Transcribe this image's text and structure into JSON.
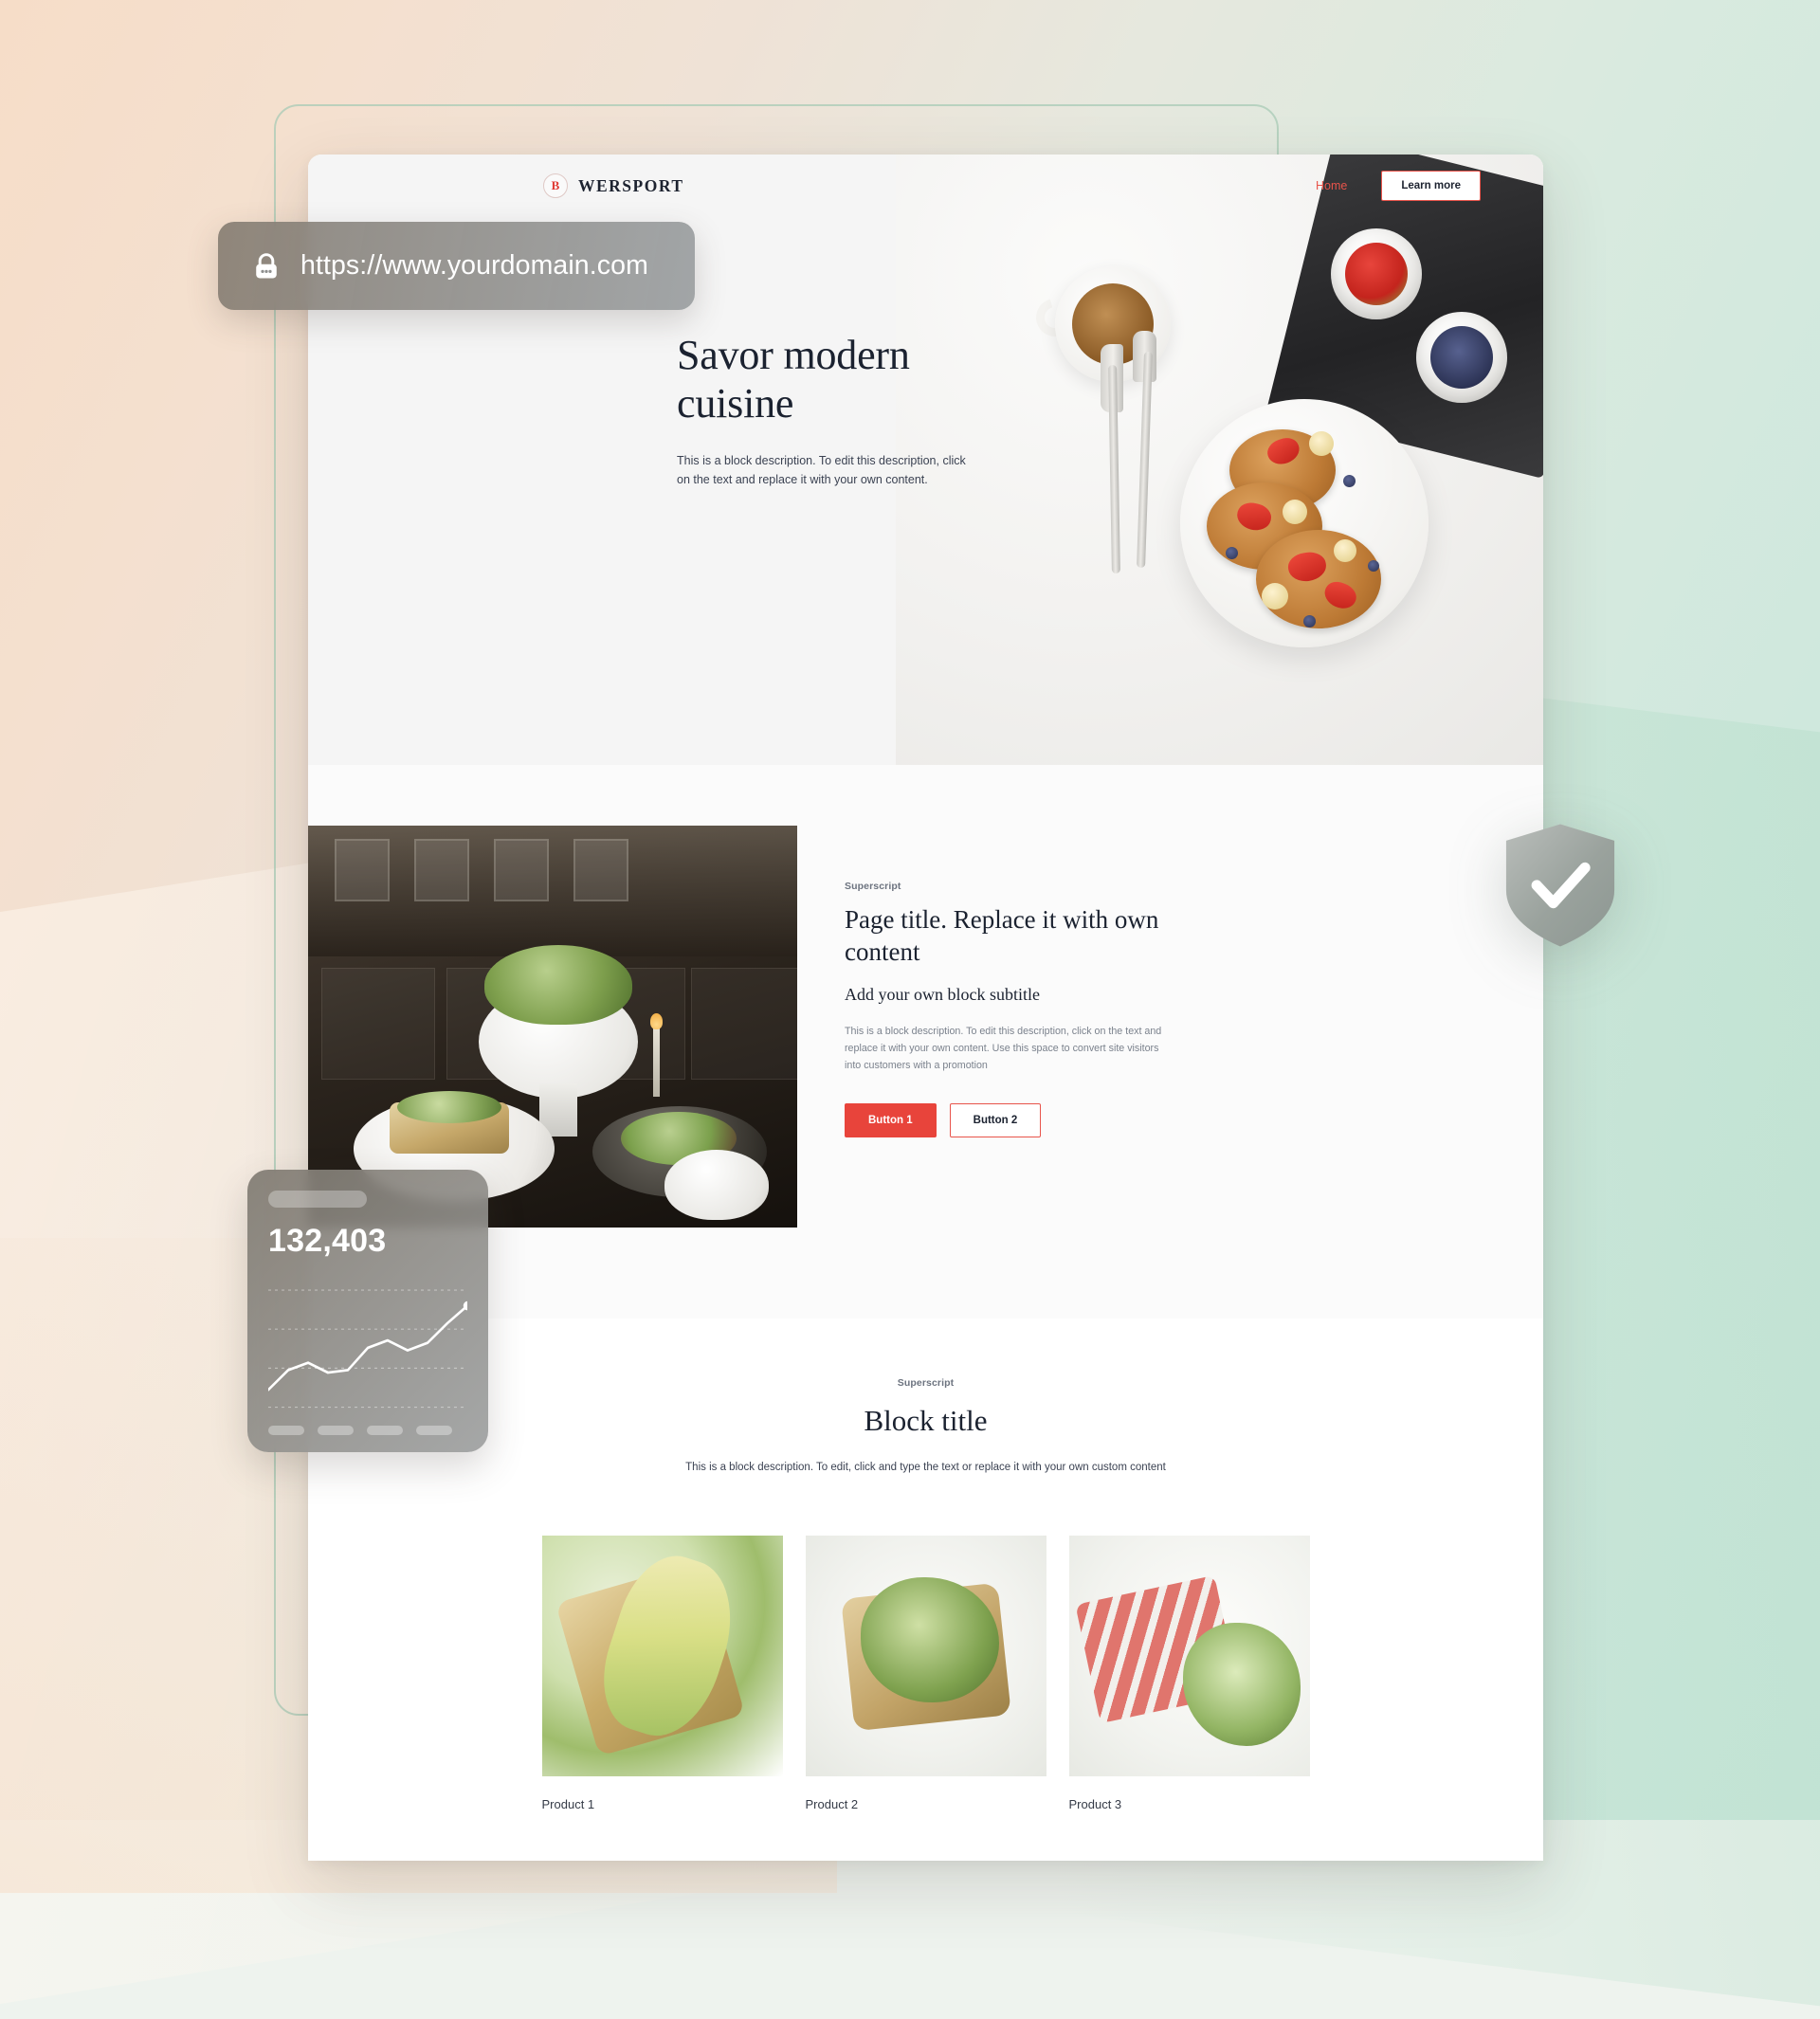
{
  "browser": {
    "url_bar": {
      "url": "https://www.yourdomain.com",
      "lock_icon": "lock-icon"
    }
  },
  "site": {
    "nav": {
      "brand_mark": "B",
      "brand_name": "WERSPORT",
      "links": [
        {
          "label": "Home"
        }
      ],
      "cta_label": "Learn more"
    },
    "hero": {
      "title_line1": "Savor modern",
      "title_line2": "cuisine",
      "description": "This is a block description. To edit this description, click on the text and replace it with your own content."
    },
    "section_feature": {
      "superscript": "Superscript",
      "title": "Page title. Replace it with own content",
      "subtitle": "Add your own block subtitle",
      "description": "This is a block description. To edit this description, click on the text and replace it with your own content. Use this space to convert site visitors into customers with a promotion",
      "buttons": [
        {
          "label": "Button 1",
          "style": "primary"
        },
        {
          "label": "Button 2",
          "style": "outline"
        }
      ]
    },
    "section_products": {
      "superscript": "Superscript",
      "title": "Block title",
      "description": "This is a block description. To edit, click and type the text or replace it with your own custom content",
      "products": [
        {
          "name": "Product 1"
        },
        {
          "name": "Product 2"
        },
        {
          "name": "Product 3"
        }
      ]
    }
  },
  "widgets": {
    "stats_card": {
      "value": "132,403",
      "skeleton_label": "",
      "chart_data": {
        "type": "line",
        "title": "132,403",
        "x": [
          0,
          1,
          2,
          3,
          4,
          5,
          6,
          7,
          8,
          9,
          10
        ],
        "values": [
          14,
          30,
          36,
          28,
          30,
          48,
          54,
          46,
          52,
          68,
          82
        ],
        "ylim": [
          0,
          100
        ],
        "grid": true,
        "xlabel": "",
        "ylabel": "",
        "legend": "none",
        "gridlines": 4,
        "endpoint_marker": true
      }
    },
    "shield_badge": {
      "icon": "shield-check-icon"
    }
  },
  "colors": {
    "accent_red": "#e8443b",
    "nav_link_red": "#e8544b",
    "text_dark": "#1b2230",
    "text_muted": "#7b828d",
    "card_overlay": "#9a9c9c",
    "backdrop_warm": "#f6ddc8",
    "backdrop_cool": "#c9e6da"
  }
}
